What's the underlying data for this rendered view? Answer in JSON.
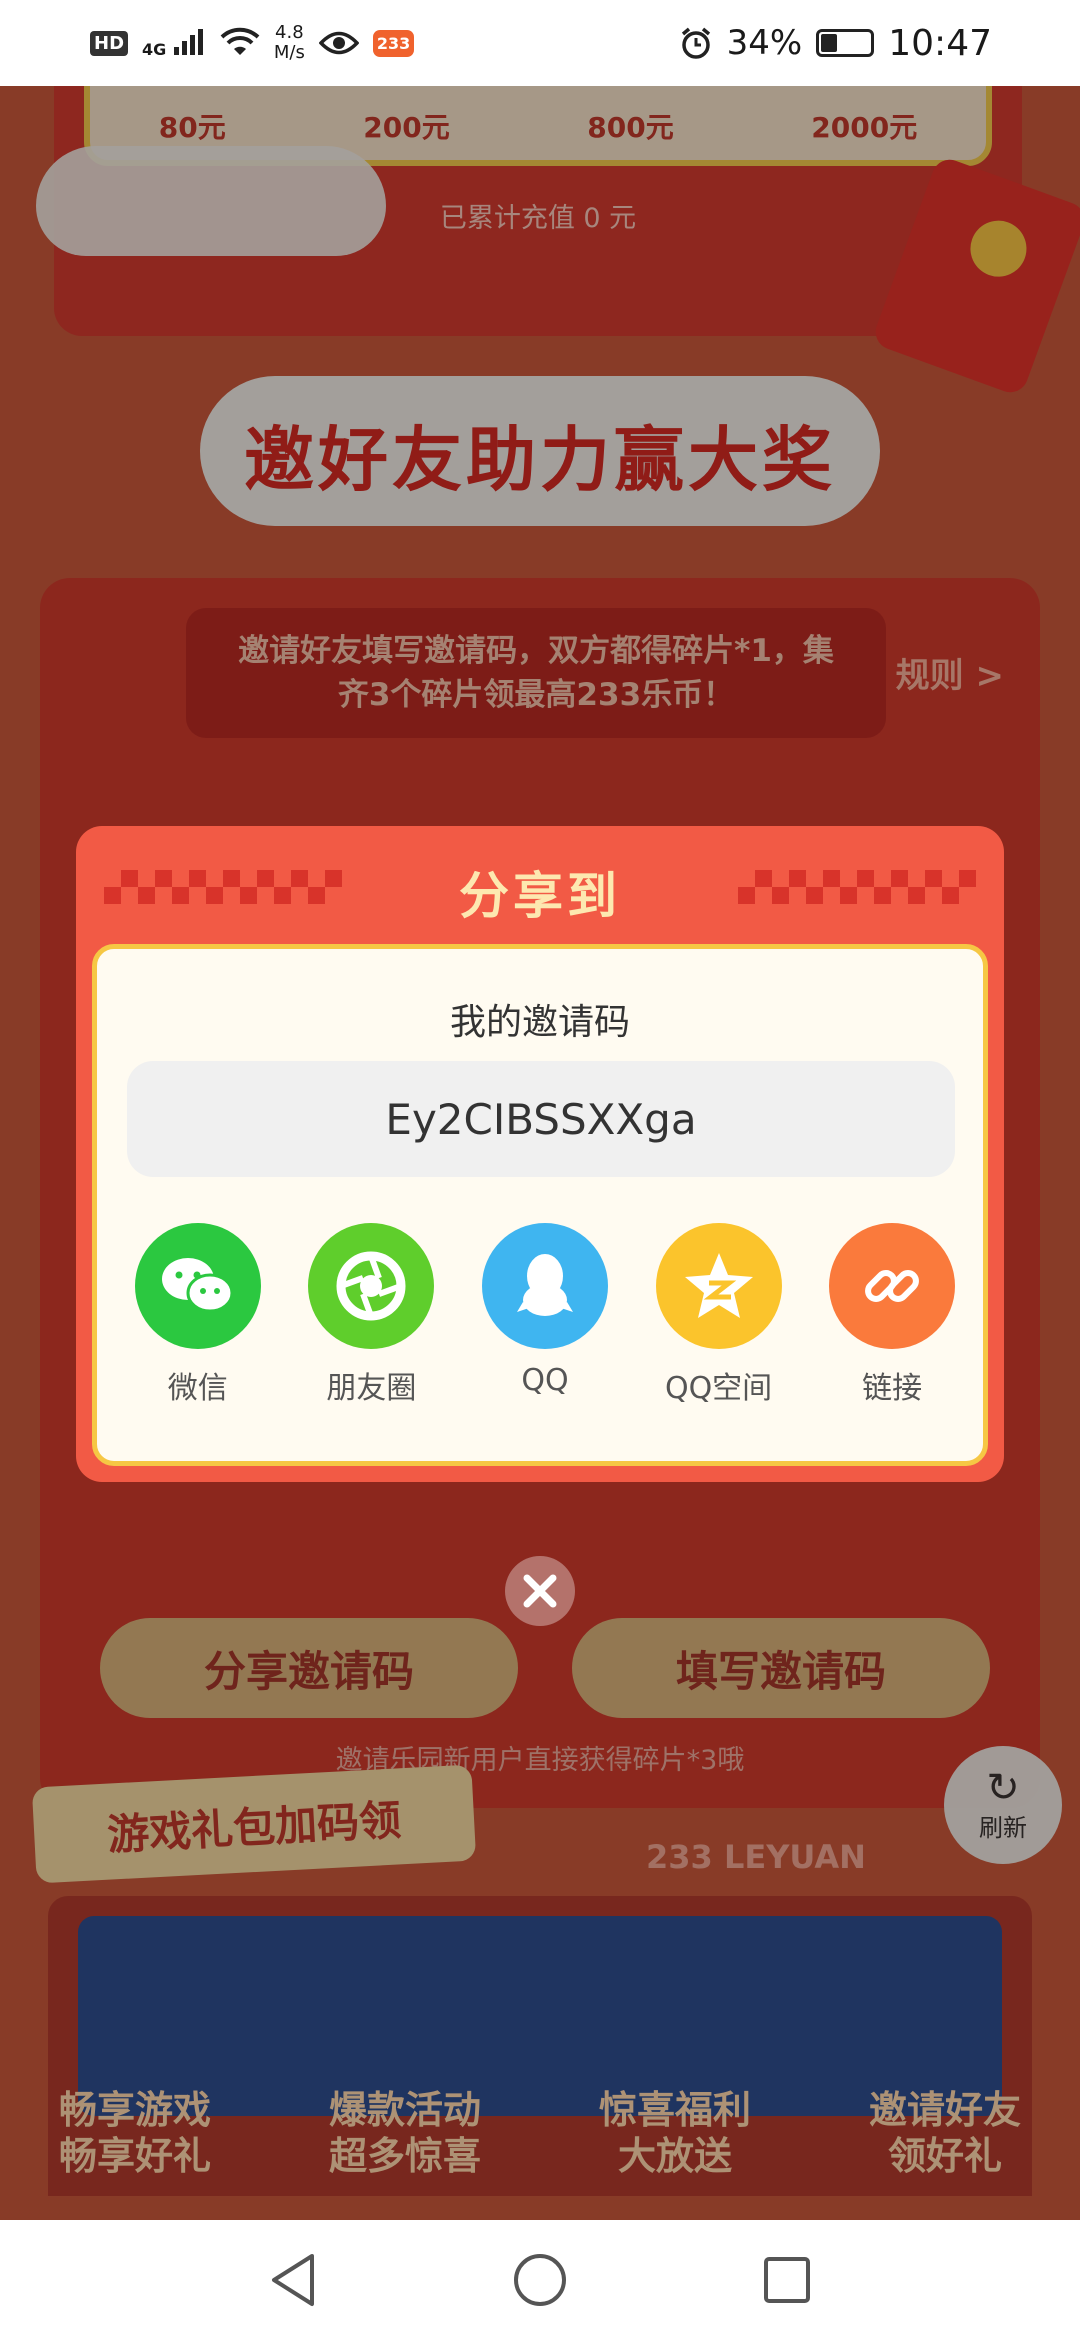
{
  "status_bar": {
    "hd": "HD",
    "signal": "4G",
    "net_speed_value": "4.8",
    "net_speed_unit": "M/s",
    "app_badge": "233",
    "battery_percent": "34%",
    "battery_level": 0.34,
    "time": "10:47"
  },
  "recharge": {
    "amounts": [
      "80元",
      "200元",
      "800元",
      "2000元"
    ],
    "total_text": "已累计充值 0 元"
  },
  "invite_section": {
    "title": "邀好友助力赢大奖",
    "rule_text": "邀请好友填写邀请码，双方都得碎片*1，集齐3个碎片领最高233乐币！",
    "rule_link": "规则 >",
    "share_code_button": "分享邀请码",
    "fill_code_button": "填写邀请码",
    "note": "邀请乐园新用户直接获得碎片*3哦"
  },
  "refresh": {
    "label": "刷新"
  },
  "gift_section": {
    "tag": "游戏礼包加码领",
    "brand": "233 LEYUAN",
    "features": [
      {
        "line1": "畅享游戏",
        "line2": "畅享好礼"
      },
      {
        "line1": "爆款活动",
        "line2": "超多惊喜"
      },
      {
        "line1": "惊喜福利",
        "line2": "大放送"
      },
      {
        "line1": "邀请好友",
        "line2": "领好礼"
      }
    ]
  },
  "share_dialog": {
    "title": "分享到",
    "code_label": "我的邀请码",
    "invite_code": "Ey2CIBSSXXga",
    "targets": [
      {
        "label": "微信",
        "icon": "wechat-icon",
        "color": "#2bc840"
      },
      {
        "label": "朋友圈",
        "icon": "moments-icon",
        "color": "#5fce2c"
      },
      {
        "label": "QQ",
        "icon": "qq-icon",
        "color": "#3fb5f0"
      },
      {
        "label": "QQ空间",
        "icon": "qzone-icon",
        "color": "#fbc42c"
      },
      {
        "label": "链接",
        "icon": "link-icon",
        "color": "#fa7a3c"
      }
    ]
  },
  "colors": {
    "dialog_bg": "#f25a45",
    "dialog_title": "#fde8b0",
    "card_border": "#f6c744",
    "accent_red": "#d42a22"
  }
}
